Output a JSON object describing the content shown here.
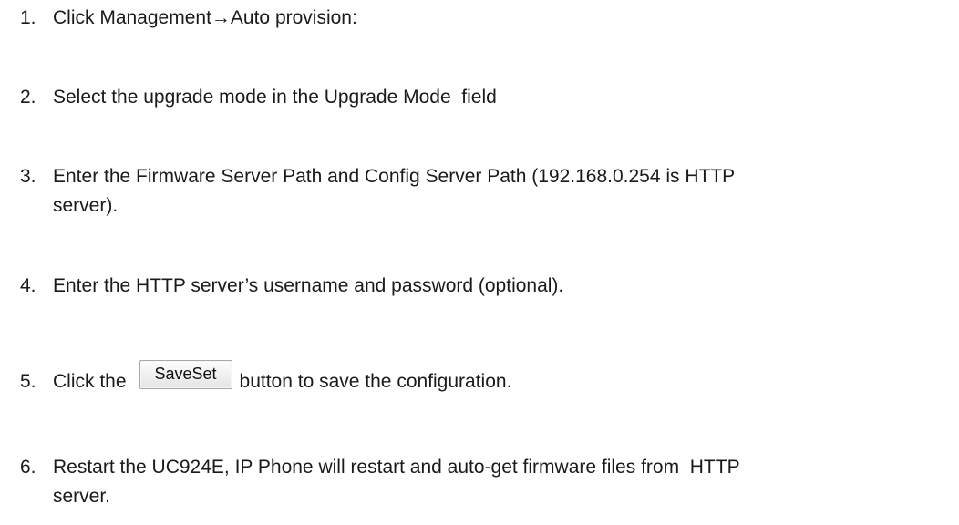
{
  "steps": [
    {
      "num": "1.",
      "text": "Click Management→Auto provision:"
    },
    {
      "num": "2.",
      "text": "Select the upgrade mode in the Upgrade Mode  field"
    },
    {
      "num": "3.",
      "line1": "Enter the Firmware Server Path and Config Server Path (192.168.0.254 is HTTP",
      "line2": "server)."
    },
    {
      "num": "4.",
      "text": "Enter the HTTP server’s username and password (optional)."
    },
    {
      "num": "5.",
      "before": "Click the",
      "button": "SaveSet",
      "after": "button to save the configuration."
    },
    {
      "num": "6.",
      "line1": "Restart the UC924E, IP Phone will restart and auto-get firmware files from  HTTP",
      "line2": "server."
    }
  ]
}
